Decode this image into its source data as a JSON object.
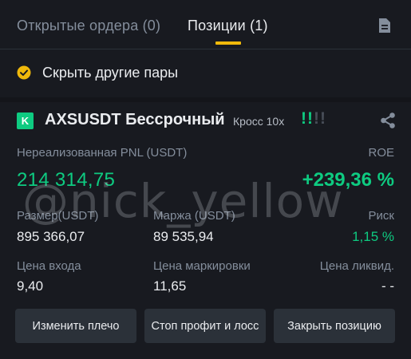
{
  "tabs": {
    "open_orders": "Открытые ордера (0)",
    "positions": "Позиции (1)"
  },
  "icons": {
    "history": "document-icon",
    "filter_check": "check-circle-icon",
    "share": "share-icon"
  },
  "filter": {
    "hide_other_pairs": "Скрыть другие пары"
  },
  "position": {
    "side_badge": "K",
    "symbol": "AXSUSDT Бессрочный",
    "margin_mode": "Кросс 10x",
    "adl_on": "!!",
    "adl_off": "!!",
    "unrealized_pnl_label": "Нереализованная PNL (USDT)",
    "unrealized_pnl": "214 314,75",
    "roe_label": "ROE",
    "roe": "+239,36 %",
    "size_label": "Размер(USDT)",
    "size": "895 366,07",
    "margin_label": "Маржа (USDT)",
    "margin": "89 535,94",
    "risk_label": "Риск",
    "risk": "1,15 %",
    "entry_price_label": "Цена входа",
    "entry_price": "9,40",
    "mark_price_label": "Цена маркировки",
    "mark_price": "11,65",
    "liq_price_label": "Цена ликвид.",
    "liq_price": "- -"
  },
  "actions": {
    "adjust_leverage": "Изменить плечо",
    "tp_sl": "Стоп профит и лосс",
    "close_position": "Закрыть позицию"
  },
  "watermark": "@nick_yellow",
  "colors": {
    "accent": "#f0b90b",
    "positive": "#0ecb81",
    "background": "#181a20",
    "button": "#2b3139"
  }
}
